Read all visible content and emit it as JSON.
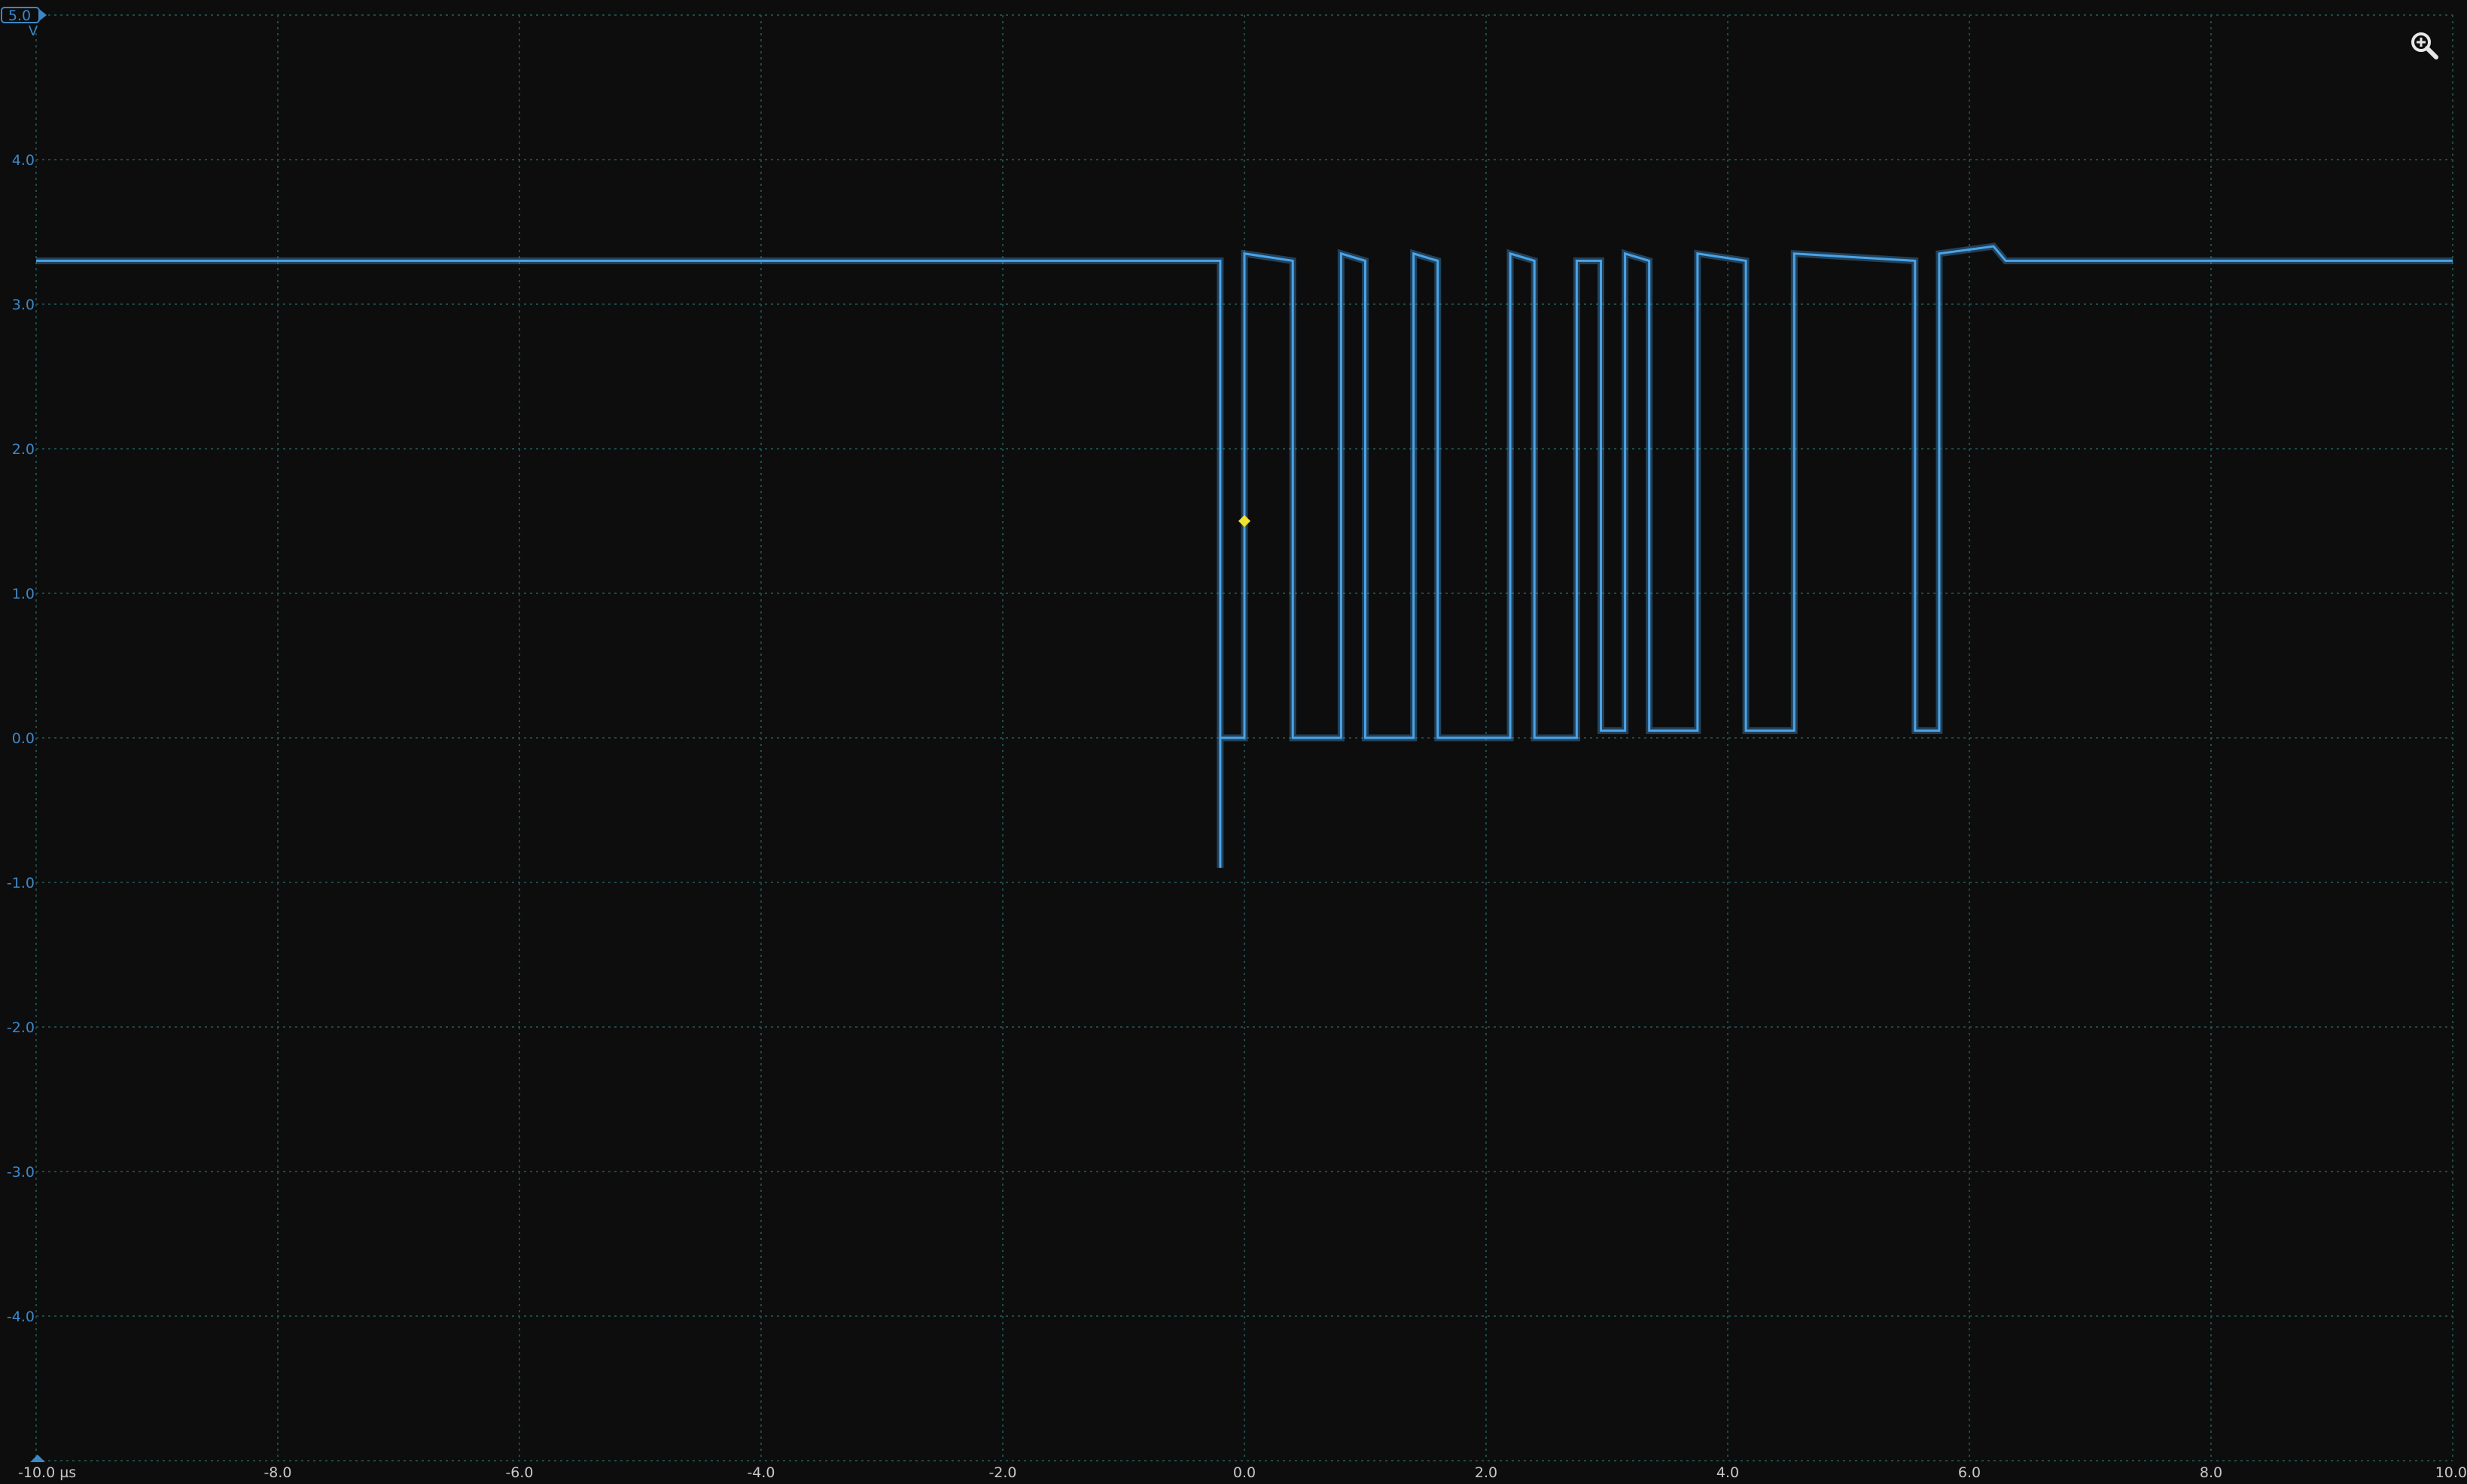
{
  "colors": {
    "background": "#0d0d0d",
    "grid": "#1d4a46",
    "trace": "#4aa3e8",
    "trigger_marker": "#f2e230",
    "axis_text": "#3d87c6"
  },
  "scope": {
    "vertical_offset_label": "5.0",
    "vertical_unit": "V",
    "zoom_icon": "zoom-in-icon"
  },
  "chart_data": {
    "type": "line",
    "x_unit": "µs",
    "y_unit": "V",
    "xlim": [
      -10.0,
      10.0
    ],
    "ylim": [
      -5.0,
      5.0
    ],
    "grid": true,
    "xticks": [
      "-10.0 µs",
      "-8.0",
      "-6.0",
      "-4.0",
      "-2.0",
      "0.0",
      "2.0",
      "4.0",
      "6.0",
      "8.0",
      "10.0"
    ],
    "xtick_values": [
      -10,
      -8,
      -6,
      -4,
      -2,
      0,
      2,
      4,
      6,
      8,
      10
    ],
    "yticks": [
      "4.0",
      "3.0",
      "2.0",
      "1.0",
      "0.0",
      "-1.0",
      "-2.0",
      "-3.0",
      "-4.0"
    ],
    "ytick_values": [
      4,
      3,
      2,
      1,
      0,
      -1,
      -2,
      -3,
      -4
    ],
    "trigger": {
      "x": 0.0,
      "y": 1.5
    },
    "series": [
      {
        "x": [
          -10.0,
          -0.2,
          -0.2,
          -0.2,
          0.0,
          0.0,
          0.4,
          0.4,
          0.8,
          0.8,
          1.0,
          1.0,
          1.4,
          1.4,
          1.6,
          1.6,
          2.2,
          2.2,
          2.4,
          2.4,
          2.75,
          2.75,
          2.95,
          2.95,
          3.15,
          3.15,
          3.35,
          3.35,
          3.75,
          3.75,
          4.15,
          4.15,
          4.55,
          4.55,
          5.55,
          5.55,
          5.75,
          5.75,
          6.2,
          6.3,
          10.0
        ],
        "y": [
          3.3,
          3.3,
          -0.9,
          0.0,
          0.0,
          3.35,
          3.3,
          0.0,
          0.0,
          3.35,
          3.3,
          0.0,
          0.0,
          3.35,
          3.3,
          0.0,
          0.0,
          3.35,
          3.3,
          0.0,
          0.0,
          3.3,
          3.3,
          0.05,
          0.05,
          3.35,
          3.3,
          0.05,
          0.05,
          3.35,
          3.3,
          0.05,
          0.05,
          3.35,
          3.3,
          0.05,
          0.05,
          3.35,
          3.4,
          3.3,
          3.3
        ]
      }
    ]
  }
}
